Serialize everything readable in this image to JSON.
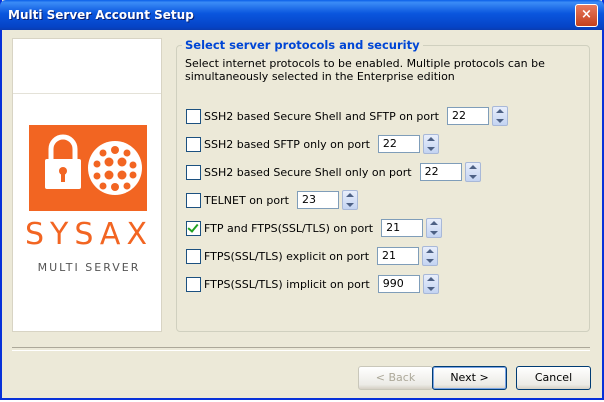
{
  "window": {
    "title": "Multi Server Account Setup",
    "close_glyph": "×"
  },
  "logo": {
    "brand": "SYSAX",
    "subtitle": "MULTI SERVER",
    "accent": "#f26522"
  },
  "group": {
    "title": "Select server protocols and security",
    "description": "Select internet protocols to be enabled. Multiple protocols can be simultaneously selected in the Enterprise edition"
  },
  "protocols": [
    {
      "label": "SSH2 based Secure Shell and SFTP on port",
      "port": "22",
      "checked": false
    },
    {
      "label": "SSH2 based SFTP only on port",
      "port": "22",
      "checked": false
    },
    {
      "label": "SSH2 based Secure Shell only on port",
      "port": "22",
      "checked": false
    },
    {
      "label": "TELNET on port",
      "port": "23",
      "checked": false
    },
    {
      "label": "FTP and FTPS(SSL/TLS) on port",
      "port": "21",
      "checked": true
    },
    {
      "label": "FTPS(SSL/TLS) explicit on port",
      "port": "21",
      "checked": false
    },
    {
      "label": "FTPS(SSL/TLS) implicit on port",
      "port": "990",
      "checked": false
    }
  ],
  "buttons": {
    "back": "< Back",
    "next": "Next >",
    "cancel": "Cancel"
  }
}
